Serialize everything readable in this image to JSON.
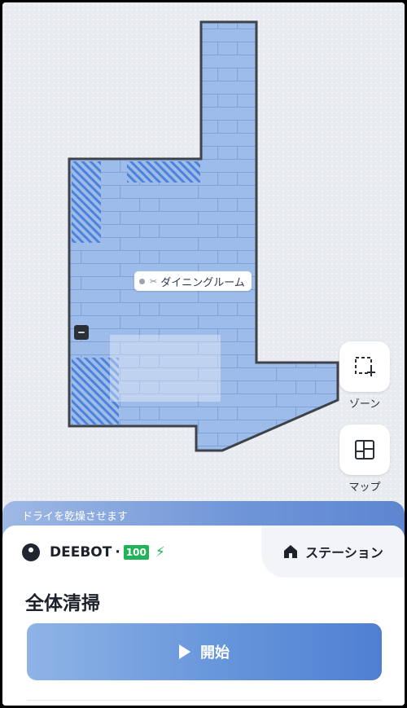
{
  "map": {
    "room_label": "ダイニングルーム",
    "colors": {
      "floor": "#9dbcea",
      "outline": "#3e4249",
      "hatch": "#3f79d6"
    }
  },
  "side_buttons": {
    "zone_label": "ゾーン",
    "map_label": "マップ"
  },
  "status": {
    "text": "ドライを乾燥させます"
  },
  "device": {
    "name": "DEEBOT",
    "separator": "·",
    "battery": "100"
  },
  "station": {
    "label": "ステーション"
  },
  "mode": {
    "title": "全体清掃"
  },
  "start": {
    "label": "開始"
  }
}
